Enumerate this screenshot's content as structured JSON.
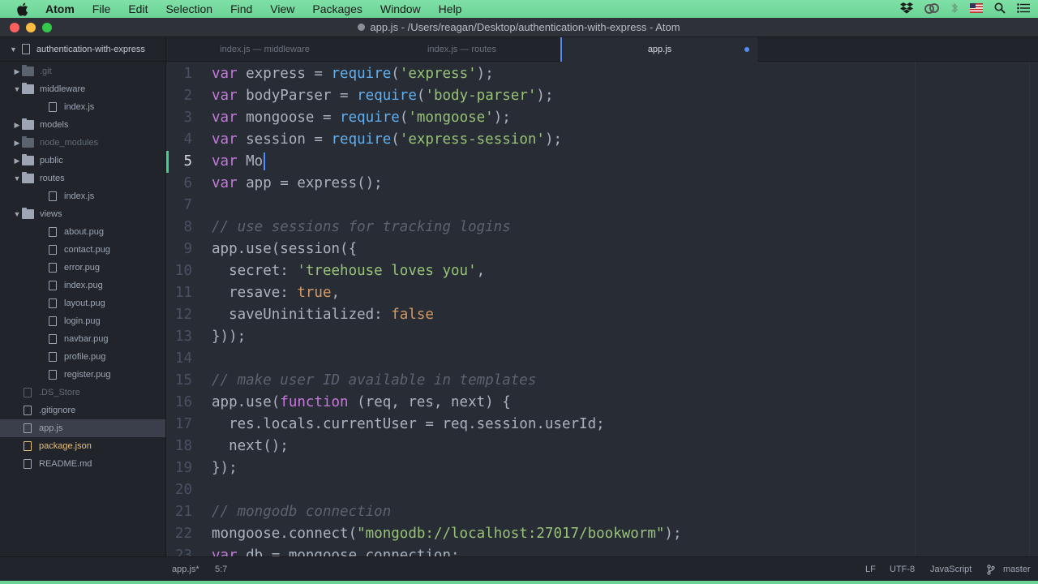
{
  "menubar": {
    "app": "Atom",
    "items": [
      "File",
      "Edit",
      "Selection",
      "Find",
      "View",
      "Packages",
      "Window",
      "Help"
    ]
  },
  "window": {
    "title": "app.js - /Users/reagan/Desktop/authentication-with-express - Atom"
  },
  "tree": {
    "root": "authentication-with-express",
    "items": [
      {
        "label": ".git",
        "kind": "folder",
        "depth": 0,
        "expanded": false,
        "ignored": true
      },
      {
        "label": "middleware",
        "kind": "folder",
        "depth": 0,
        "expanded": true
      },
      {
        "label": "index.js",
        "kind": "file",
        "depth": 1
      },
      {
        "label": "models",
        "kind": "folder",
        "depth": 0,
        "expanded": false
      },
      {
        "label": "node_modules",
        "kind": "folder",
        "depth": 0,
        "expanded": false,
        "ignored": true
      },
      {
        "label": "public",
        "kind": "folder",
        "depth": 0,
        "expanded": false
      },
      {
        "label": "routes",
        "kind": "folder",
        "depth": 0,
        "expanded": true
      },
      {
        "label": "index.js",
        "kind": "file",
        "depth": 1
      },
      {
        "label": "views",
        "kind": "folder",
        "depth": 0,
        "expanded": true
      },
      {
        "label": "about.pug",
        "kind": "file",
        "depth": 1
      },
      {
        "label": "contact.pug",
        "kind": "file",
        "depth": 1
      },
      {
        "label": "error.pug",
        "kind": "file",
        "depth": 1
      },
      {
        "label": "index.pug",
        "kind": "file",
        "depth": 1
      },
      {
        "label": "layout.pug",
        "kind": "file",
        "depth": 1
      },
      {
        "label": "login.pug",
        "kind": "file",
        "depth": 1
      },
      {
        "label": "navbar.pug",
        "kind": "file",
        "depth": 1
      },
      {
        "label": "profile.pug",
        "kind": "file",
        "depth": 1
      },
      {
        "label": "register.pug",
        "kind": "file",
        "depth": 1
      },
      {
        "label": ".DS_Store",
        "kind": "file",
        "depth": 0,
        "ignored": true
      },
      {
        "label": ".gitignore",
        "kind": "file",
        "depth": 0
      },
      {
        "label": "app.js",
        "kind": "file",
        "depth": 0,
        "selected": true
      },
      {
        "label": "package.json",
        "kind": "file",
        "depth": 0,
        "modified": true
      },
      {
        "label": "README.md",
        "kind": "file",
        "depth": 0
      }
    ]
  },
  "tabs": [
    {
      "label": "index.js — middleware",
      "active": false
    },
    {
      "label": "index.js — routes",
      "active": false
    },
    {
      "label": "app.js",
      "active": true,
      "modified": true
    }
  ],
  "editor": {
    "cursor_line": 5,
    "lines": [
      [
        [
          "kw",
          "var"
        ],
        [
          "plain",
          " express = "
        ],
        [
          "fn",
          "require"
        ],
        [
          "plain",
          "("
        ],
        [
          "str",
          "'express'"
        ],
        [
          "plain",
          ");"
        ]
      ],
      [
        [
          "kw",
          "var"
        ],
        [
          "plain",
          " bodyParser = "
        ],
        [
          "fn",
          "require"
        ],
        [
          "plain",
          "("
        ],
        [
          "str",
          "'body-parser'"
        ],
        [
          "plain",
          ");"
        ]
      ],
      [
        [
          "kw",
          "var"
        ],
        [
          "plain",
          " mongoose = "
        ],
        [
          "fn",
          "require"
        ],
        [
          "plain",
          "("
        ],
        [
          "str",
          "'mongoose'"
        ],
        [
          "plain",
          ");"
        ]
      ],
      [
        [
          "kw",
          "var"
        ],
        [
          "plain",
          " session = "
        ],
        [
          "fn",
          "require"
        ],
        [
          "plain",
          "("
        ],
        [
          "str",
          "'express-session'"
        ],
        [
          "plain",
          ");"
        ]
      ],
      [
        [
          "kw",
          "var"
        ],
        [
          "plain",
          " Mo"
        ]
      ],
      [
        [
          "kw",
          "var"
        ],
        [
          "plain",
          " app = express();"
        ]
      ],
      [],
      [
        [
          "com",
          "// use sessions for tracking logins"
        ]
      ],
      [
        [
          "plain",
          "app.use(session({"
        ]
      ],
      [
        [
          "plain",
          "  secret: "
        ],
        [
          "str",
          "'treehouse loves you'"
        ],
        [
          "plain",
          ","
        ]
      ],
      [
        [
          "plain",
          "  resave: "
        ],
        [
          "num",
          "true"
        ],
        [
          "plain",
          ","
        ]
      ],
      [
        [
          "plain",
          "  saveUninitialized: "
        ],
        [
          "num",
          "false"
        ]
      ],
      [
        [
          "plain",
          "}));"
        ]
      ],
      [],
      [
        [
          "com",
          "// make user ID available in templates"
        ]
      ],
      [
        [
          "plain",
          "app.use("
        ],
        [
          "kw",
          "function"
        ],
        [
          "plain",
          " (req, res, next) {"
        ]
      ],
      [
        [
          "plain",
          "  res.locals.currentUser = req.session.userId;"
        ]
      ],
      [
        [
          "plain",
          "  next();"
        ]
      ],
      [
        [
          "plain",
          "});"
        ]
      ],
      [],
      [
        [
          "com",
          "// mongodb connection"
        ]
      ],
      [
        [
          "plain",
          "mongoose.connect("
        ],
        [
          "str",
          "\"mongodb://localhost:27017/bookworm\""
        ],
        [
          "plain",
          ");"
        ]
      ],
      [
        [
          "kw",
          "var"
        ],
        [
          "plain",
          " db = mongoose.connection;"
        ]
      ]
    ]
  },
  "status": {
    "file": "app.js*",
    "position": "5:7",
    "line_ending": "LF",
    "encoding": "UTF-8",
    "grammar": "JavaScript",
    "branch": "master"
  }
}
